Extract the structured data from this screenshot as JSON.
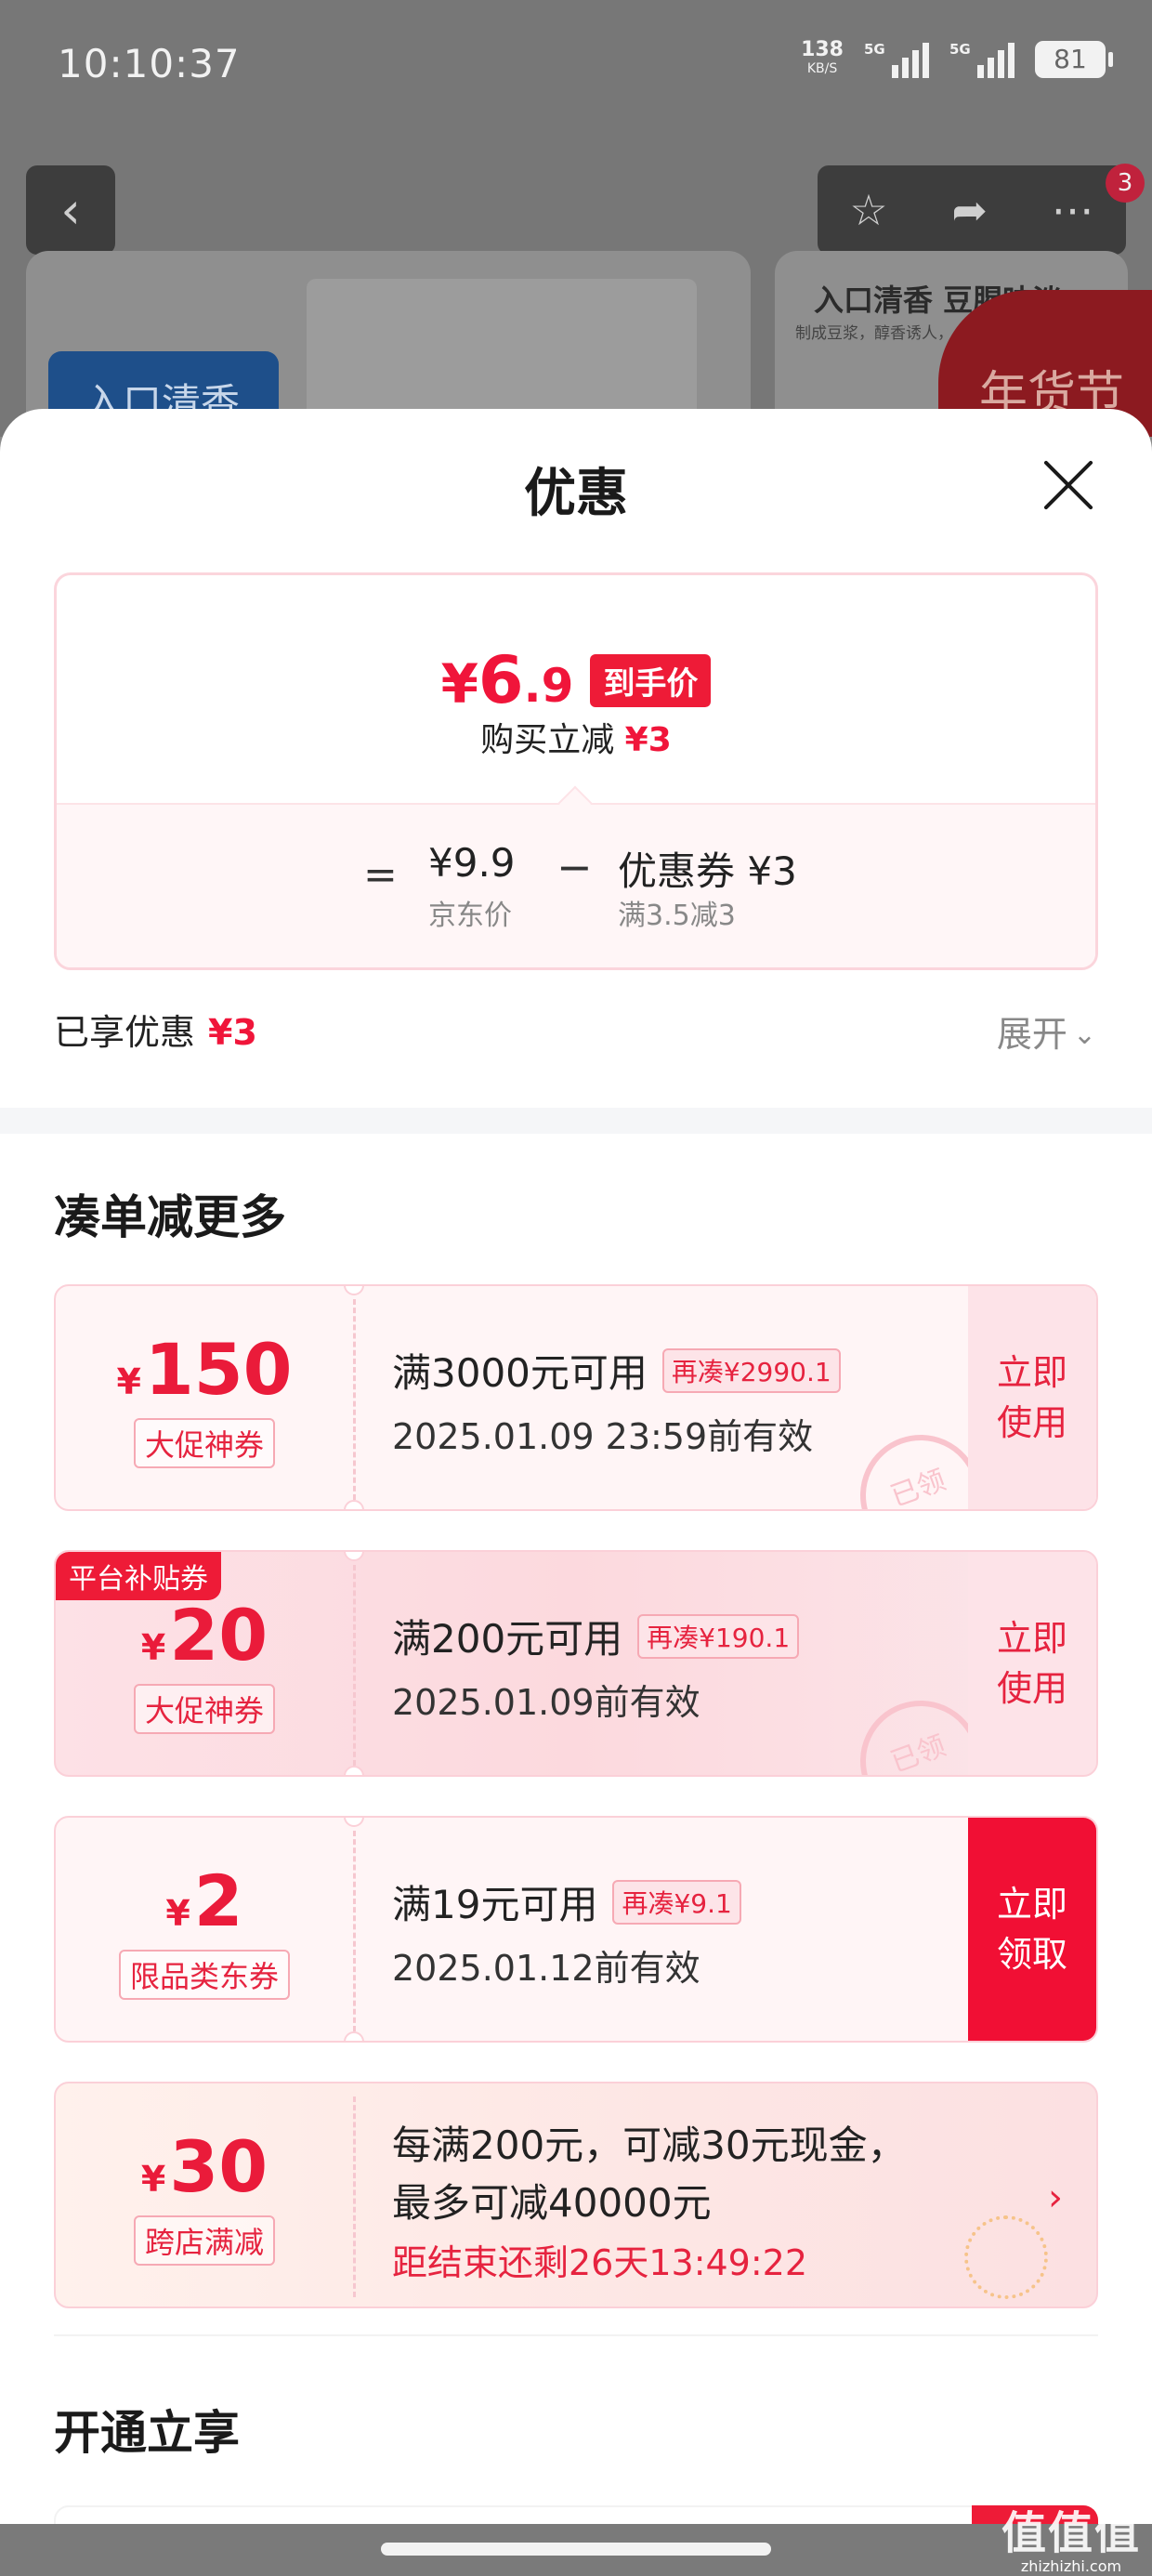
{
  "status_bar": {
    "time": "10:10:37",
    "net_speed": "138",
    "net_unit": "KB/S",
    "sim1_label": "5G",
    "sim2_label": "5G",
    "battery": "81"
  },
  "background": {
    "cart_badge": "3",
    "product_tag": "入口清香",
    "side_title": "入口清香 豆腥味淡",
    "side_sub": "制成豆浆，醇香诱人，",
    "festival_text": "年货节"
  },
  "sheet": {
    "title": "优惠",
    "price": {
      "yen": "¥",
      "integer": "6",
      "decimal": ".9",
      "final_tag": "到手价",
      "sub_label": "购买立减",
      "sub_value": "¥3"
    },
    "formula": {
      "eq": "=",
      "jd_price": "¥9.9",
      "jd_price_label": "京东价",
      "minus": "−",
      "coupon": "优惠券 ¥3",
      "coupon_rule": "满3.5减3"
    },
    "enjoyed_label": "已享优惠",
    "enjoyed_value": "¥3",
    "expand_label": "展开"
  },
  "section_more": {
    "title": "凑单减更多"
  },
  "coupons": [
    {
      "yen": "¥",
      "amount": "150",
      "type": "大促神券",
      "condition": "满3000元可用",
      "need": "再凑¥2990.1",
      "date": "2025.01.09 23:59前有效",
      "button": "立即\n使用",
      "stamp": "已领"
    },
    {
      "flag": "平台补贴券",
      "yen": "¥",
      "amount": "20",
      "type": "大促神券",
      "condition": "满200元可用",
      "need": "再凑¥190.1",
      "date": "2025.01.09前有效",
      "button": "立即\n使用",
      "stamp": "已领"
    },
    {
      "yen": "¥",
      "amount": "2",
      "type": "限品类东券",
      "condition": "满19元可用",
      "need": "再凑¥9.1",
      "date": "2025.01.12前有效",
      "button": "立即\n领取"
    },
    {
      "yen": "¥",
      "amount": "30",
      "type": "跨店满减",
      "line1": "每满200元，可减30元现金，",
      "line2": "最多可减40000元",
      "countdown": "距结束还剩26天13:49:22",
      "arrow": "›"
    }
  ],
  "section_open": {
    "title": "开通立享"
  },
  "watermark": {
    "big": "值值值",
    "small": "zhizhizhi.com"
  }
}
